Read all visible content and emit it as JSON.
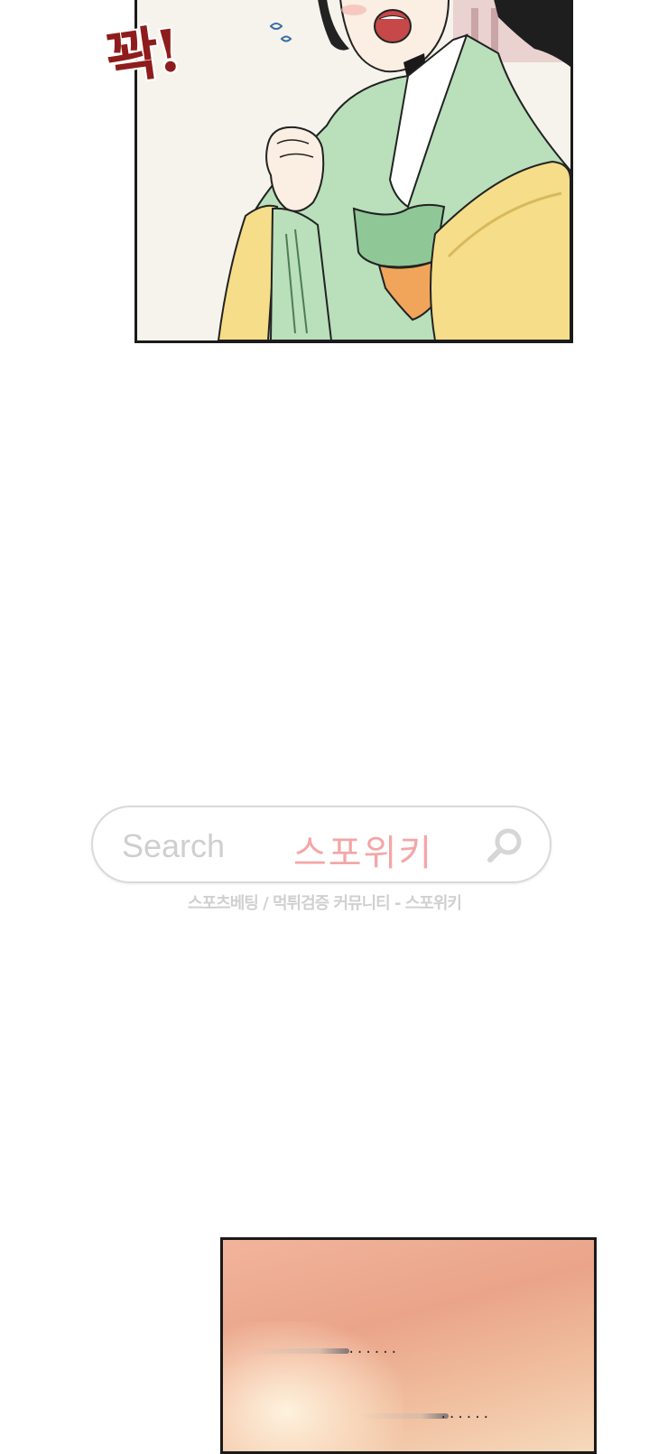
{
  "top_panel": {
    "sound_effect": "꽉!"
  },
  "watermark": {
    "search_placeholder": "Search",
    "brand": "스포위키",
    "caption": "스포츠베팅 / 먹튀검증 커뮤니티 - 스포위키",
    "search_icon": "search-icon",
    "colors": {
      "brand": "#f3a6a6",
      "placeholder": "#cfcfcf",
      "border": "#d9d9d9"
    }
  },
  "bottom_panel": {
    "ellipsis_1": "......",
    "ellipsis_2": "......"
  }
}
